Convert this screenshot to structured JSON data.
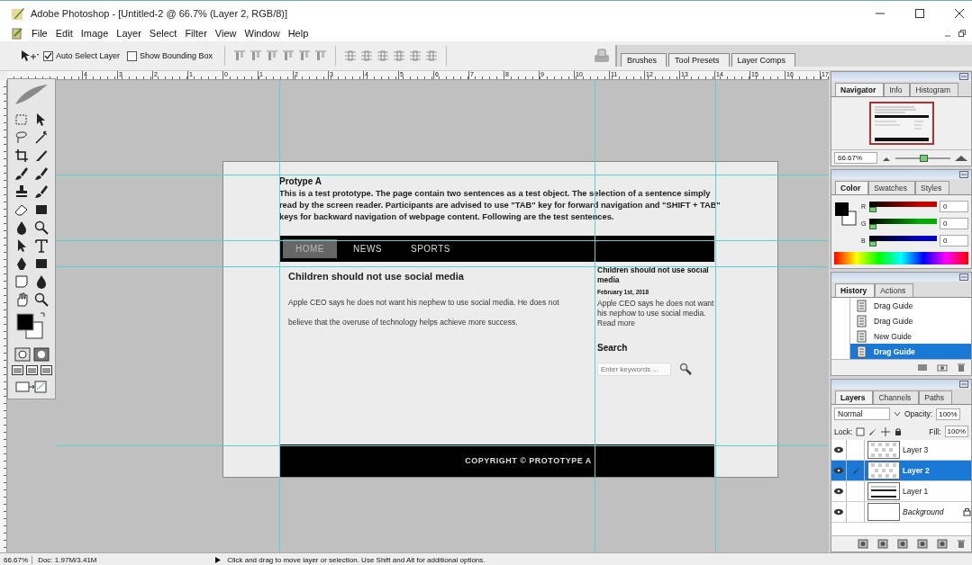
{
  "window": {
    "title": "Adobe Photoshop - [Untitled-2 @ 66.7% (Layer 2, RGB/8)]"
  },
  "menu": [
    "File",
    "Edit",
    "Image",
    "Layer",
    "Select",
    "Filter",
    "View",
    "Window",
    "Help"
  ],
  "options_bar": {
    "checkboxes": [
      {
        "label": "Auto Select Layer",
        "checked": true
      },
      {
        "label": "Show Bounding Box",
        "checked": false
      }
    ]
  },
  "palette_well": {
    "tabs": [
      "Brushes",
      "Tool Presets",
      "Layer Comps"
    ]
  },
  "ruler": {
    "labels": [
      "4",
      "3",
      "2",
      "1",
      "0",
      "1",
      "2",
      "3",
      "4",
      "5",
      "6",
      "7",
      "8",
      "9",
      "10",
      "11",
      "12",
      "13",
      "14",
      "15",
      "16",
      "17"
    ]
  },
  "document": {
    "title": "Protype A",
    "intro": "This is a test prototype. The page contain two sentences as a test object. The selection of a sentence simply read by the screen reader. Participants are advised to use \"TAB\" key for forward navigation and \"SHIFT + TAB\" keys for backward navigation of webpage content. Following are the test sentences.",
    "nav": [
      {
        "label": "HOME",
        "selected": true
      },
      {
        "label": "NEWS",
        "selected": false
      },
      {
        "label": "SPORTS",
        "selected": false
      }
    ],
    "article": {
      "heading": "Children should not use social media",
      "text": "Apple CEO says he does not want his nephew to use social media. He does not believe that the overuse of technology helps achieve more success."
    },
    "sidebar": {
      "heading": "Children should not use social media",
      "date": "February 1st, 2018",
      "text": "Apple CEO says he does not want his nephow to use social media.",
      "link": "Read more",
      "search_title": "Search",
      "search_placeholder": "Enter keywords ..."
    },
    "footer": "COPYRIGHT © PROTOTYPE A"
  },
  "navigator": {
    "tabs": [
      {
        "label": "Navigator",
        "selected": true
      },
      {
        "label": "Info",
        "selected": false
      },
      {
        "label": "Histogram",
        "selected": false
      }
    ],
    "zoom": "66.67%",
    "level": 0.5
  },
  "color": {
    "tabs": [
      {
        "label": "Color",
        "selected": true
      },
      {
        "label": "Swatches",
        "selected": false
      },
      {
        "label": "Styles",
        "selected": false
      }
    ],
    "channels": [
      {
        "label": "R",
        "value": "0",
        "level": 0,
        "color": "#c00000"
      },
      {
        "label": "G",
        "value": "0",
        "level": 0,
        "color": "#00b000"
      },
      {
        "label": "B",
        "value": "0",
        "level": 0,
        "color": "#0000c0"
      }
    ]
  },
  "history": {
    "tabs": [
      {
        "label": "History",
        "selected": true
      },
      {
        "label": "Actions",
        "selected": false
      }
    ],
    "items": [
      {
        "label": "Drag Guide",
        "selected": false
      },
      {
        "label": "Drag Guide",
        "selected": false
      },
      {
        "label": "New Guide",
        "selected": false
      },
      {
        "label": "Drag Guide",
        "selected": true
      }
    ]
  },
  "layers": {
    "tabs": [
      {
        "label": "Layers",
        "selected": true
      },
      {
        "label": "Channels",
        "selected": false
      },
      {
        "label": "Paths",
        "selected": false
      }
    ],
    "blend_mode": "Normal",
    "opacity_label": "Opacity:",
    "opacity": "100%",
    "lock_label": "Lock:",
    "fill_label": "Fill:",
    "fill": "100%",
    "items": [
      {
        "name": "Layer 3",
        "kind": "transparent",
        "visible": true,
        "selected": false,
        "locked": false
      },
      {
        "name": "Layer 2",
        "kind": "transparent",
        "visible": true,
        "selected": true,
        "locked": false
      },
      {
        "name": "Layer 1",
        "kind": "page",
        "visible": true,
        "selected": false,
        "locked": false
      },
      {
        "name": "Background",
        "kind": "background",
        "visible": true,
        "selected": false,
        "locked": true
      }
    ]
  },
  "status_bar": {
    "zoom": "66.67%",
    "doc": "Doc: 1.97M/3.41M",
    "hint": "Click and drag to move layer or selection.  Use Shift and Alt for additional options."
  }
}
